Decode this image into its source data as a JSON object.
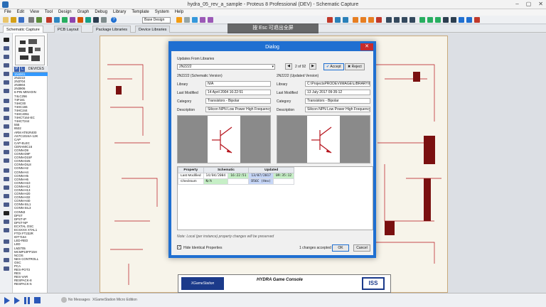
{
  "window": {
    "title": "hydra_05_rev_a_sample - Proteus 8 Professional (DEV) - Schematic Capture",
    "controls": [
      "–",
      "▢",
      "✕"
    ]
  },
  "menu": [
    "File",
    "Edit",
    "View",
    "Tool",
    "Design",
    "Graph",
    "Debug",
    "Library",
    "Template",
    "System",
    "Help"
  ],
  "toolbar": {
    "grid_select": "Base Design"
  },
  "tabs": [
    {
      "label": "Schematic Capture",
      "active": true
    },
    {
      "label": "PCB Layout",
      "active": false
    },
    {
      "label": "Package Libraries",
      "active": false
    },
    {
      "label": "Device Libraries",
      "active": false
    }
  ],
  "overlay_hint": "按  Esc  可退出全屏",
  "device_panel": {
    "p_label": "P",
    "l_label": "L",
    "header": "DEVICES",
    "items": [
      "1N4001",
      "2N2222",
      "2N3704",
      "2N3904",
      "2N3906",
      "6-PIN MINI-DIN",
      "74LC256",
      "74F161",
      "74HC00",
      "74HC165",
      "74HC244",
      "74HC4051",
      "74HCT164-EC",
      "74HCT244",
      "555",
      "8532",
      "ARM AT91R400",
      "AS7C1024A-12K",
      "CAP",
      "CAP-ELEC",
      "CERAMIC16",
      "CONN-D9",
      "CONN-D9F",
      "CONN-D15F",
      "CONN-D25",
      "CONN-DIL8",
      "CONN-H2",
      "CONN-H4",
      "CONN-H5",
      "CONN-H6",
      "CONN-H10",
      "CONN-H12",
      "CONN-H13",
      "CONN-H20",
      "CONN-H32",
      "CONN-H40",
      "CONN-SIL1",
      "CONN-SIL3",
      "CONN3",
      "DPST",
      "DPST-IP",
      "DPST-NP",
      "ECXTAL OSC",
      "ECSXXX XTAL1",
      "FTDI FT232R",
      "IDT7164",
      "LED-RED",
      "LED",
      "LM2705",
      "MCMP10FP15H",
      "NCOS",
      "NES CONTROLL",
      "OSC",
      "PCA",
      "RES-POT3",
      "RES",
      "RES-VAR",
      "RESPACK-8",
      "RESPACK-5"
    ]
  },
  "dialog": {
    "title": "Dialog",
    "close": "✕",
    "updates_label": "Updates From Libraries",
    "selected_part": "2N2222",
    "prev": "◀",
    "next": "▶",
    "counter": "2 of 92",
    "accept": "Accept",
    "reject": "Reject",
    "left": {
      "heading": "2N2222 (Schematic Version)",
      "library_label": "Library",
      "library": "N/A",
      "modified_label": "Last Modified",
      "modified": "14 April 2004 16:22:51",
      "category_label": "Category",
      "category": "Transistors - Bipolar",
      "description_label": "Description",
      "description": "Silicon NPN Low Power High Frequency Bipolar Transist"
    },
    "right": {
      "heading": "2N2222 (Updated Version)",
      "library_label": "Library",
      "library": "C:\\ProjectsPRODEV\\IMAGE\\LIBRARY\\BIPOLAR.LIB",
      "modified_label": "Last Modified",
      "modified": "13 July 2017 09:35:12",
      "category_label": "Category",
      "category": "Transistors - Bipolar",
      "description_label": "Description",
      "description": "Silicon NPN Low Power High Frequency Bipolar Transist"
    },
    "table": {
      "headers": [
        "Property",
        "Schematic",
        "Updated"
      ],
      "rows": [
        {
          "property": "Last Modified",
          "schem_a": "14/04/2004",
          "schem_b": "16:22:51",
          "upd_a": "13/07/2017",
          "upd_b": "09:35:12"
        },
        {
          "property": "Checksum",
          "schem_a": "N/A",
          "schem_b": "",
          "upd_a": "D56C (Hex)",
          "upd_b": ""
        }
      ]
    },
    "note": "Note: Local (per instance) property changes will be preserved",
    "hide_identical": "Hide Identical Properties",
    "changes": "1 changes accepted",
    "ok": "OK",
    "cancel": "Cancel"
  },
  "titleblock": {
    "logo": "XGameStation",
    "title": "HYDRA Game Console",
    "logo2": "ISS"
  },
  "status": {
    "messages": "No Messages",
    "edition": "XGameStation Micro Edition"
  }
}
